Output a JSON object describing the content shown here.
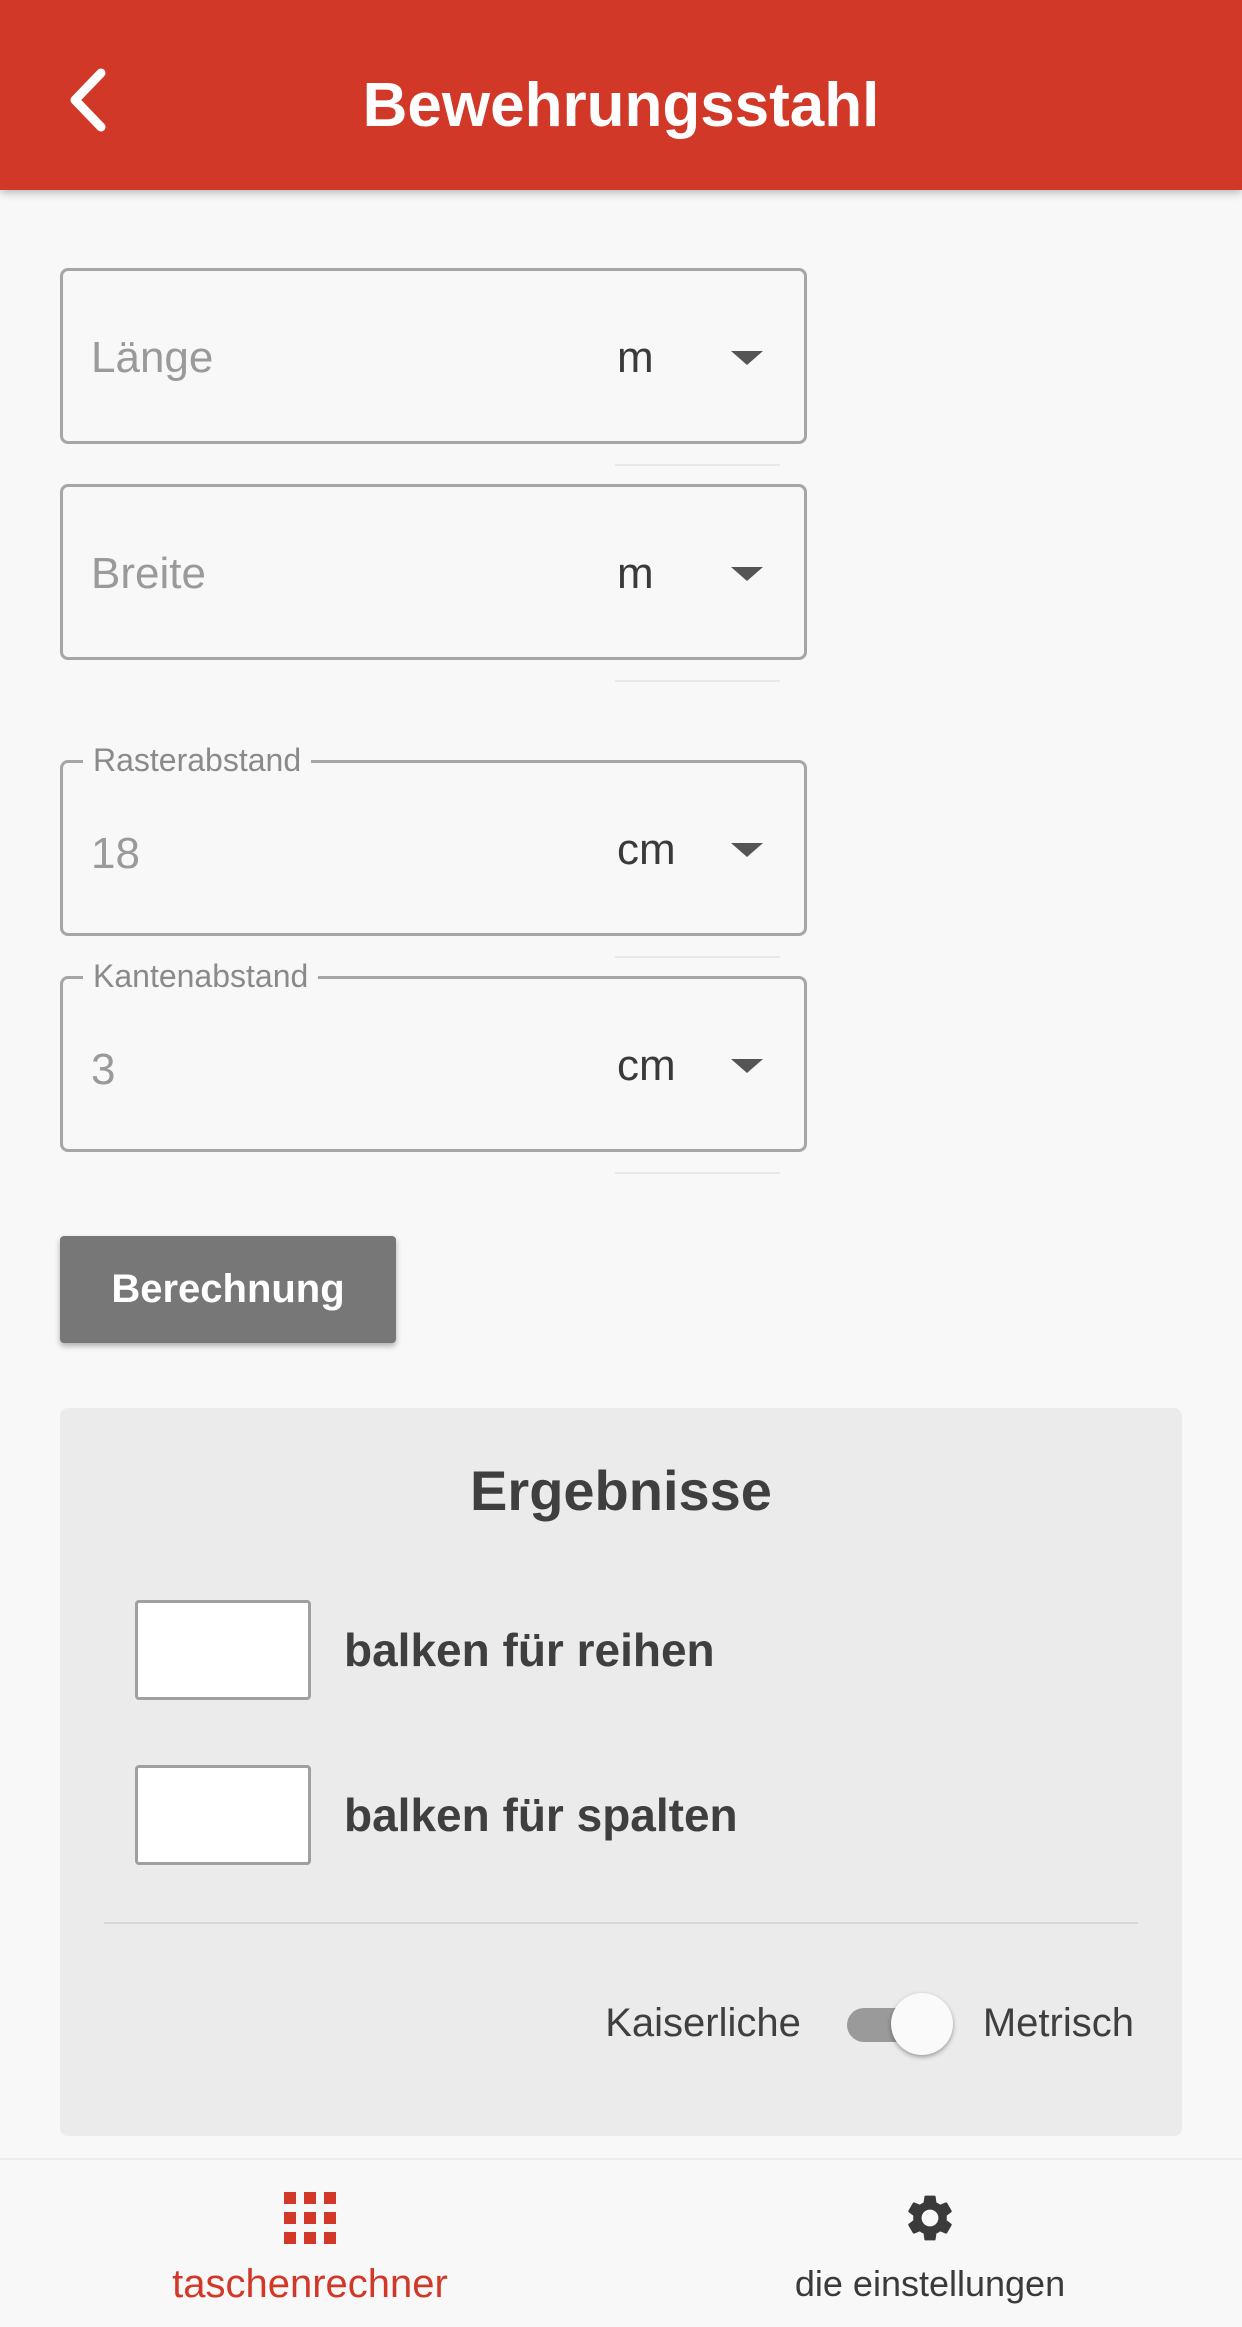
{
  "header": {
    "title": "Bewehrungsstahl",
    "back_icon": "chevron-left-icon"
  },
  "form": {
    "laenge": {
      "placeholder": "Länge",
      "unit": "m"
    },
    "breite": {
      "placeholder": "Breite",
      "unit": "m"
    },
    "rasterabstand": {
      "label": "Rasterabstand",
      "value": "18",
      "unit": "cm"
    },
    "kantenabstand": {
      "label": "Kantenabstand",
      "value": "3",
      "unit": "cm"
    },
    "calculate_label": "Berechnung"
  },
  "results": {
    "title": "Ergebnisse",
    "rows": [
      {
        "label": "balken für reihen",
        "value": ""
      },
      {
        "label": "balken für spalten",
        "value": ""
      }
    ],
    "toggle": {
      "left_label": "Kaiserliche",
      "right_label": "Metrisch",
      "selected": "Metrisch"
    }
  },
  "bottom_nav": {
    "items": [
      {
        "label": "taschenrechner",
        "icon": "grid-icon",
        "active": true
      },
      {
        "label": "die einstellungen",
        "icon": "gear-icon",
        "active": false
      }
    ]
  },
  "colors": {
    "primary": "#d23828",
    "button": "#777777",
    "panel": "#ebebeb"
  }
}
